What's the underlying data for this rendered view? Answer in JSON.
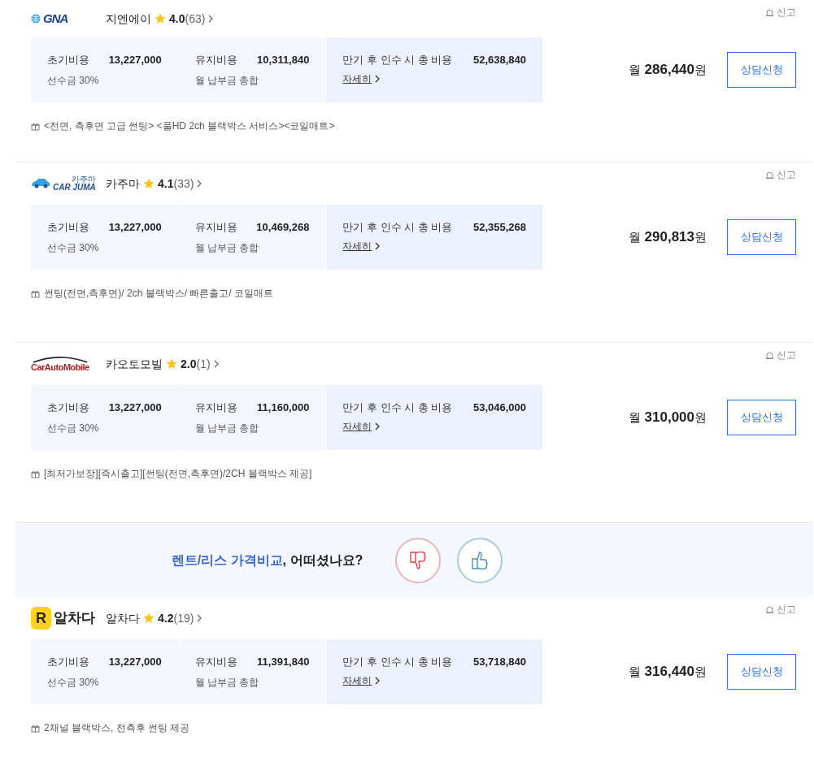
{
  "items": [
    {
      "kind": "offer",
      "logo": {
        "kind": "gna",
        "text": "GNA"
      },
      "name": "지엔에이",
      "rating": "4.0",
      "reviews": "(63)",
      "report": "신고",
      "costs": [
        {
          "label": "초기비용",
          "value": "13,227,000",
          "note": "선수금 30%"
        },
        {
          "label": "유지비용",
          "value": "10,311,840",
          "note": "월 납부금 총합"
        },
        {
          "label": "만기 후 인수 시 총 비용",
          "value": "52,638,840",
          "link": "자세히"
        }
      ],
      "benefits": "<전면, 측후면 고급 썬팅> <풀HD 2ch 블랙박스 서비스><코일매트>",
      "price_prefix": "월",
      "price": "286,440",
      "price_unit": "원",
      "button": "상담신청"
    },
    {
      "kind": "offer",
      "logo": {
        "kind": "carjuma",
        "text": "CAR JUMA",
        "sub": "카주마"
      },
      "name": "카주마",
      "rating": "4.1",
      "reviews": "(33)",
      "report": "신고",
      "costs": [
        {
          "label": "초기비용",
          "value": "13,227,000",
          "note": "선수금 30%"
        },
        {
          "label": "유지비용",
          "value": "10,469,268",
          "note": "월 납부금 총합"
        },
        {
          "label": "만기 후 인수 시 총 비용",
          "value": "52,355,268",
          "link": "자세히"
        }
      ],
      "benefits": "썬팅(전면,측후면)/ 2ch 블랙박스/ 빠른출고/ 코일매트",
      "price_prefix": "월",
      "price": "290,813",
      "price_unit": "원",
      "button": "상담신청"
    },
    {
      "kind": "offer",
      "logo": {
        "kind": "carauto",
        "text": "CarAutoMobile"
      },
      "name": "카오토모빌",
      "rating": "2.0",
      "reviews": "(1)",
      "report": "신고",
      "costs": [
        {
          "label": "초기비용",
          "value": "13,227,000",
          "note": "선수금 30%"
        },
        {
          "label": "유지비용",
          "value": "11,160,000",
          "note": "월 납부금 총합"
        },
        {
          "label": "만기 후 인수 시 총 비용",
          "value": "53,046,000",
          "link": "자세히"
        }
      ],
      "benefits": "[최저가보장][즉시출고][썬팅(전면,측후면)/2CH 블랙박스 제공]",
      "price_prefix": "월",
      "price": "310,000",
      "price_unit": "원",
      "button": "상담신청"
    },
    {
      "kind": "feedback",
      "highlight": "렌트/리스 가격비교",
      "text": ", 어떠셨나요?"
    },
    {
      "kind": "offer",
      "logo": {
        "kind": "alchada",
        "text": "알차다",
        "badge": "R"
      },
      "name": "알차다",
      "rating": "4.2",
      "reviews": "(19)",
      "report": "신고",
      "costs": [
        {
          "label": "초기비용",
          "value": "13,227,000",
          "note": "선수금 30%"
        },
        {
          "label": "유지비용",
          "value": "11,391,840",
          "note": "월 납부금 총합"
        },
        {
          "label": "만기 후 인수 시 총 비용",
          "value": "53,718,840",
          "link": "자세히"
        }
      ],
      "benefits": "2채널 블랙박스, 전측후 썬팅 제공",
      "price_prefix": "월",
      "price": "316,440",
      "price_unit": "원",
      "button": "상담신청"
    }
  ]
}
